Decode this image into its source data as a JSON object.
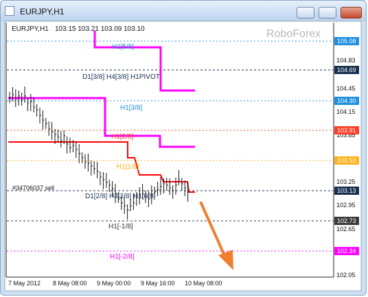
{
  "window": {
    "title": "EURJPY,H1"
  },
  "chart_info": {
    "symbol_tf": "EURJPY,H1",
    "ohlc": "103.15 103.21 103.09 103.10"
  },
  "watermark": "RoboForex",
  "level_labels": [
    "H1[5/8]",
    "D1[3/8] H4[3/8] H1PIVOT",
    "H1[3/8]",
    "H1[2/8]",
    "H1[1/8]",
    "D1[2/8] H4[2/8] H1[0/8]",
    "H1[-1/8]",
    "H1[-2/8]"
  ],
  "order_label": "#34706037 sell",
  "price_badges": [
    "105.08",
    "104.69",
    "104.30",
    "103.91",
    "103.52",
    "103.13",
    "102.73",
    "102.34"
  ],
  "y_ticks": [
    "104.83",
    "104.45",
    "104.15",
    "103.85",
    "103.25",
    "102.95",
    "102.65",
    "102.35",
    "102.05"
  ],
  "x_ticks": [
    "7 May 2012",
    "8 May 08:00",
    "9 May 00:00",
    "9 May 16:00",
    "10 May 08:00"
  ],
  "colors": {
    "magenta": "#ff00ff",
    "red": "#ff0000",
    "arrow": "#f08030",
    "badge_blue": "#1f8fe0",
    "badge_red": "#ff3c28",
    "badge_orange": "#ffb21a",
    "badge_dark": "#183050"
  }
}
